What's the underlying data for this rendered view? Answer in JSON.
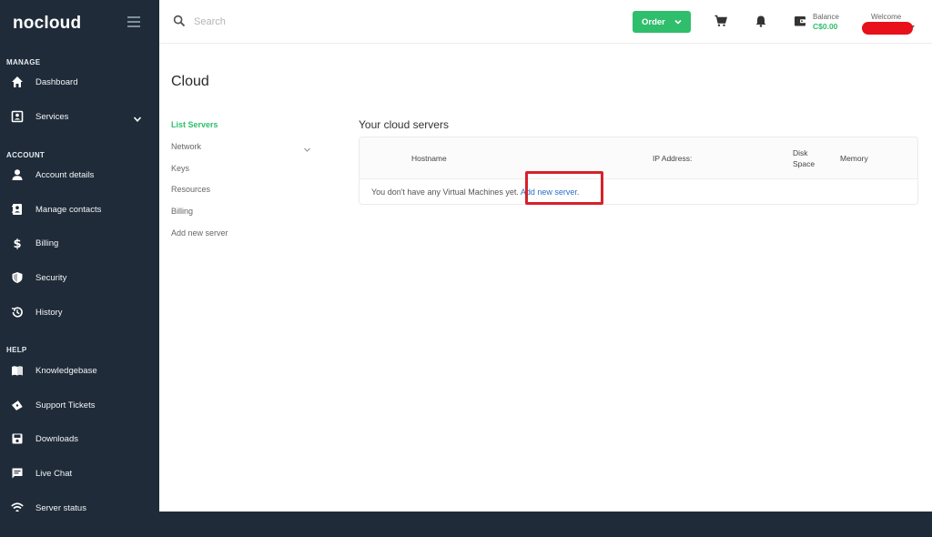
{
  "sidebar": {
    "logo": "nocloud",
    "sections": {
      "manage": "MANAGE",
      "account": "ACCOUNT",
      "help": "HELP"
    },
    "items": [
      {
        "label": "Dashboard",
        "icon": "home-icon"
      },
      {
        "label": "Services",
        "icon": "services-icon"
      },
      {
        "label": "Account details",
        "icon": "user-icon"
      },
      {
        "label": "Manage contacts",
        "icon": "contacts-icon"
      },
      {
        "label": "Billing",
        "icon": "dollar-icon"
      },
      {
        "label": "Security",
        "icon": "shield-icon"
      },
      {
        "label": "History",
        "icon": "history-icon"
      },
      {
        "label": "Knowledgebase",
        "icon": "book-icon"
      },
      {
        "label": "Support Tickets",
        "icon": "ticket-icon"
      },
      {
        "label": "Downloads",
        "icon": "download-icon"
      },
      {
        "label": "Live Chat",
        "icon": "chat-icon"
      },
      {
        "label": "Server status",
        "icon": "wifi-icon"
      }
    ]
  },
  "topbar": {
    "search_placeholder": "Search",
    "order_label": "Order",
    "balance_label": "Balance",
    "balance_value": "C$0.00",
    "welcome_label": "Welcome"
  },
  "main": {
    "title": "Cloud",
    "subnav": [
      "List Servers",
      "Network",
      "Keys",
      "Resources",
      "Billing",
      "Add new server"
    ],
    "section_title": "Your cloud servers",
    "table": {
      "headers": [
        "Hostname",
        "IP Address:",
        "Disk Space",
        "Memory"
      ],
      "empty_message": "You don't have any Virtual Machines yet.",
      "empty_link": "Add new server."
    }
  },
  "colors": {
    "sidebar_bg": "#1f2b38",
    "accent_green": "#2fbe6c",
    "highlight_red": "#d8202a",
    "link_blue": "#2b6fc7"
  }
}
